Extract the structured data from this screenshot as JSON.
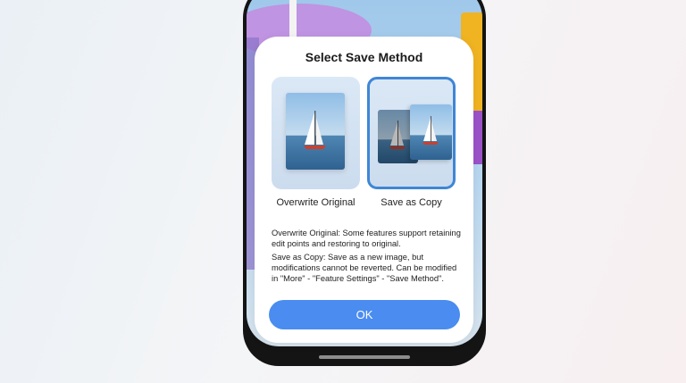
{
  "dialog": {
    "title": "Select Save Method",
    "options": [
      {
        "label": "Overwrite Original",
        "selected": false,
        "icon": "single-photo-icon"
      },
      {
        "label": "Save as Copy",
        "selected": true,
        "icon": "photo-copy-icon"
      }
    ],
    "description": [
      "Overwrite Original: Some features support retaining edit points and restoring to original.",
      "Save as Copy: Save as a new image, but modifications cannot be reverted. Can be modified in \"More\" - \"Feature Settings\" - \"Save Method\"."
    ],
    "ok_label": "OK"
  },
  "colors": {
    "accent": "#4a8cf0",
    "selected_border": "#3f86d6",
    "phone_frame": "#141414",
    "dialog_bg": "#ffffff"
  }
}
